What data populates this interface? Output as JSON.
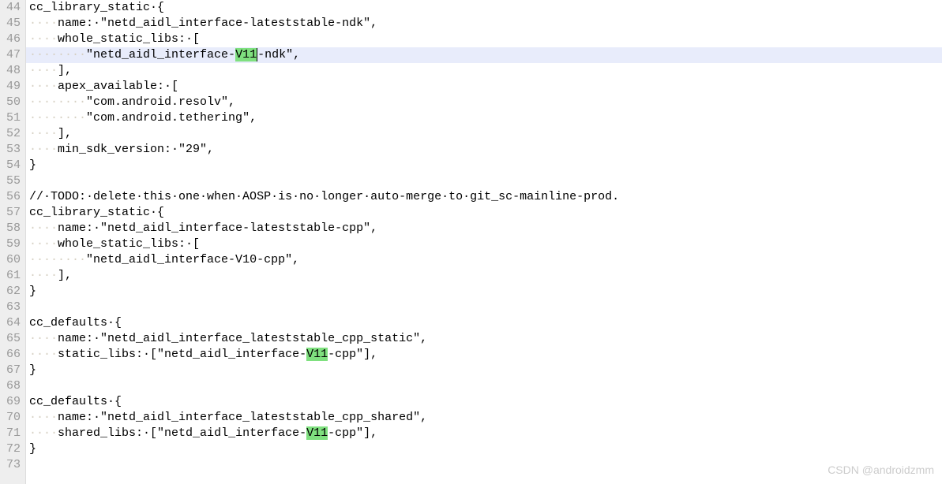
{
  "watermark": "CSDN @androidzmm",
  "lines": [
    {
      "num": 44,
      "indent": 0,
      "pre": "cc_library_static·",
      "post": "{",
      "hl": false
    },
    {
      "num": 45,
      "indent": 4,
      "pre": "name:·\"netd_aidl_interface-lateststable-ndk\",",
      "post": "",
      "hl": false
    },
    {
      "num": 46,
      "indent": 4,
      "pre": "whole_static_libs:·[",
      "post": "",
      "hl": false
    },
    {
      "num": 47,
      "indent": 8,
      "pre": "\"netd_aidl_interface-",
      "mark": "V11",
      "post": "-ndk\",",
      "hl": true,
      "caret": true
    },
    {
      "num": 48,
      "indent": 4,
      "pre": "],",
      "post": "",
      "hl": false
    },
    {
      "num": 49,
      "indent": 4,
      "pre": "apex_available:·[",
      "post": "",
      "hl": false
    },
    {
      "num": 50,
      "indent": 8,
      "pre": "\"com.android.resolv\",",
      "post": "",
      "hl": false
    },
    {
      "num": 51,
      "indent": 8,
      "pre": "\"com.android.tethering\",",
      "post": "",
      "hl": false
    },
    {
      "num": 52,
      "indent": 4,
      "pre": "],",
      "post": "",
      "hl": false
    },
    {
      "num": 53,
      "indent": 4,
      "pre": "min_sdk_version:·\"29\",",
      "post": "",
      "hl": false
    },
    {
      "num": 54,
      "indent": 0,
      "pre": "}",
      "post": "",
      "hl": false
    },
    {
      "num": 55,
      "indent": 0,
      "pre": "",
      "post": "",
      "hl": false
    },
    {
      "num": 56,
      "indent": 0,
      "pre": "//·TODO:·delete·this·one·when·AOSP·is·no·longer·auto-merge·to·git_sc-mainline-prod.",
      "post": "",
      "hl": false
    },
    {
      "num": 57,
      "indent": 0,
      "pre": "cc_library_static·",
      "post": "{",
      "hl": false
    },
    {
      "num": 58,
      "indent": 4,
      "pre": "name:·\"netd_aidl_interface-lateststable-cpp\",",
      "post": "",
      "hl": false
    },
    {
      "num": 59,
      "indent": 4,
      "pre": "whole_static_libs:·[",
      "post": "",
      "hl": false
    },
    {
      "num": 60,
      "indent": 8,
      "pre": "\"netd_aidl_interface-V10-cpp\",",
      "post": "",
      "hl": false
    },
    {
      "num": 61,
      "indent": 4,
      "pre": "],",
      "post": "",
      "hl": false
    },
    {
      "num": 62,
      "indent": 0,
      "pre": "}",
      "post": "",
      "hl": false
    },
    {
      "num": 63,
      "indent": 0,
      "pre": "",
      "post": "",
      "hl": false
    },
    {
      "num": 64,
      "indent": 0,
      "pre": "cc_defaults·",
      "post": "{",
      "hl": false
    },
    {
      "num": 65,
      "indent": 4,
      "pre": "name:·\"netd_aidl_interface_lateststable_cpp_static\",",
      "post": "",
      "hl": false
    },
    {
      "num": 66,
      "indent": 4,
      "pre": "static_libs:·[\"netd_aidl_interface-",
      "mark": "V11",
      "post": "-cpp\"],",
      "hl": false
    },
    {
      "num": 67,
      "indent": 0,
      "pre": "}",
      "post": "",
      "hl": false
    },
    {
      "num": 68,
      "indent": 0,
      "pre": "",
      "post": "",
      "hl": false
    },
    {
      "num": 69,
      "indent": 0,
      "pre": "cc_defaults·",
      "post": "{",
      "hl": false
    },
    {
      "num": 70,
      "indent": 4,
      "pre": "name:·\"netd_aidl_interface_lateststable_cpp_shared\",",
      "post": "",
      "hl": false
    },
    {
      "num": 71,
      "indent": 4,
      "pre": "shared_libs:·[\"netd_aidl_interface-",
      "mark": "V11",
      "post": "-cpp\"],",
      "hl": false
    },
    {
      "num": 72,
      "indent": 0,
      "pre": "}",
      "post": "",
      "hl": false
    },
    {
      "num": 73,
      "indent": 0,
      "pre": "",
      "post": "",
      "hl": false
    }
  ]
}
